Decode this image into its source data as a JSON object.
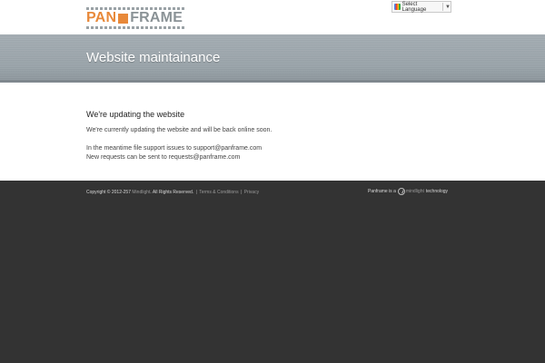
{
  "logo": {
    "word1": "PAN",
    "word2": "FRAME",
    "accent_color": "#e8893a",
    "secondary_color": "#8a9296"
  },
  "language": {
    "label": "Select Language",
    "icon": "google-translate-icon",
    "arrow": "▼"
  },
  "banner": {
    "title": "Website maintainance"
  },
  "content": {
    "heading": "We're updating the website",
    "line1": "We're currently updating the website and will be back online soon.",
    "line2": "In the meantime file support issues to support@panframe.com",
    "line3": "New requests can be sent to requests@panframe.com"
  },
  "footer": {
    "copyright_prefix": "Copyright © 2012-257",
    "company_link": "Mindlight",
    "rights": ". All Rights Reserved.",
    "separator": "|",
    "terms_link": "Terms & Conditions",
    "privacy_link": "Privacy",
    "tech_prefix": "Panframe is a",
    "tech_brand": "mindlight",
    "tech_suffix": "technology",
    "tech_icon": "mindlight-logo-icon"
  }
}
